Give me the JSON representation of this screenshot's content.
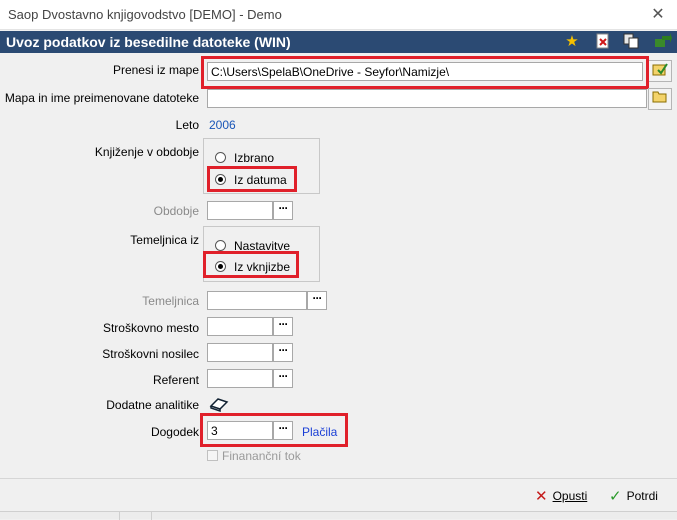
{
  "window": {
    "title": "Saop Dvostavno knjigovodstvo [DEMO] - Demo",
    "close_glyph": "✕"
  },
  "header": {
    "title": "Uvoz podatkov iz besedilne datoteke (WIN)",
    "icons": [
      "star-icon",
      "delete-document-icon",
      "copy-icon",
      "export-arrow-icon"
    ]
  },
  "form": {
    "source_folder": {
      "label": "Prenesi iz mape",
      "value": "C:\\Users\\SpelaB\\OneDrive - Seyfor\\Namizje\\"
    },
    "renamed_file": {
      "label": "Mapa in ime preimenovane datoteke",
      "value": ""
    },
    "year": {
      "label": "Leto",
      "value": "2006"
    },
    "posting_period": {
      "label": "Knjiženje v obdobje",
      "options": [
        "Izbrano",
        "Iz datuma"
      ],
      "selected": "Iz datuma"
    },
    "period": {
      "label": "Obdobje",
      "value": ""
    },
    "journal_from": {
      "label": "Temeljnica iz",
      "options": [
        "Nastavitve",
        "Iz vknjizbe"
      ],
      "selected": "Iz vknjizbe"
    },
    "journal": {
      "label": "Temeljnica",
      "value": ""
    },
    "cost_center": {
      "label": "Stroškovno mesto",
      "value": ""
    },
    "cost_carrier": {
      "label": "Stroškovni nosilec",
      "value": ""
    },
    "referent": {
      "label": "Referent",
      "value": ""
    },
    "additional_analytics": {
      "label": "Dodatne analitike"
    },
    "event": {
      "label": "Dogodek",
      "value": "3",
      "link": "Plačila"
    },
    "financial_flow": {
      "label": "Finananční tok",
      "checked": false
    }
  },
  "lookup_button_label": "···",
  "footer": {
    "cancel": "Opusti",
    "confirm": "Potrdi"
  },
  "colors": {
    "header_bg": "#2b4a73",
    "highlight": "#e0202a",
    "link": "#1a3fd6"
  }
}
